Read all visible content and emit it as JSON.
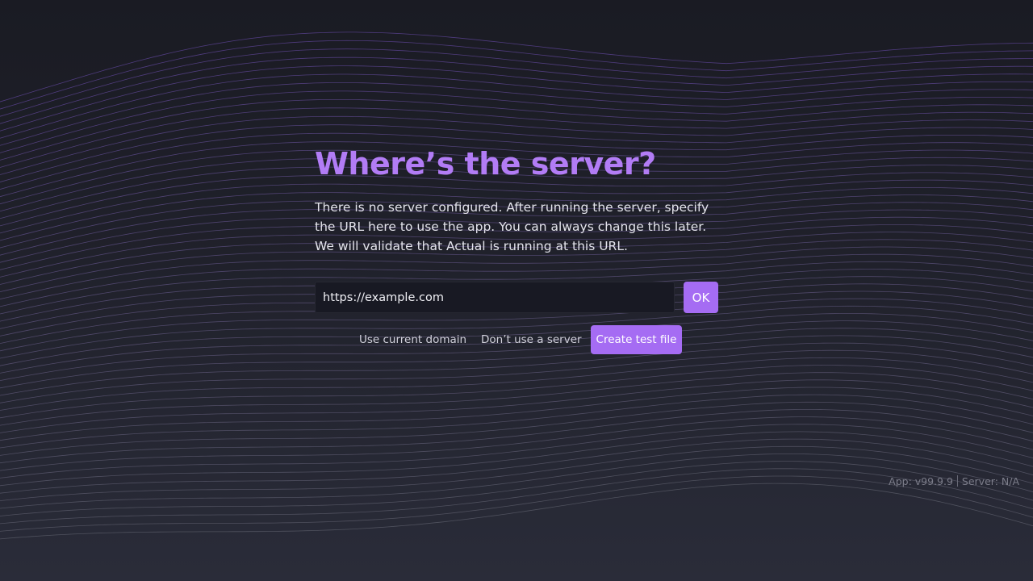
{
  "page": {
    "title": "Where’s the server?",
    "description": "There is no server configured. After running the server, specify the URL here to use the app. You can always change this later. We will validate that Actual is running at this URL."
  },
  "server_url": {
    "value": "https://example.com",
    "placeholder": "https://example.com"
  },
  "buttons": {
    "ok": "OK",
    "use_current_domain": "Use current domain",
    "dont_use_server": "Don’t use a server",
    "create_test_file": "Create test file"
  },
  "version": {
    "app": "App: v99.9.9",
    "server": "Server: N/A"
  },
  "colors": {
    "accent": "#a56cf3",
    "title": "#b27cf5",
    "background": "#1a1b23",
    "wave_top": "#7a55c8",
    "wave_bottom": "#8a8b98"
  }
}
